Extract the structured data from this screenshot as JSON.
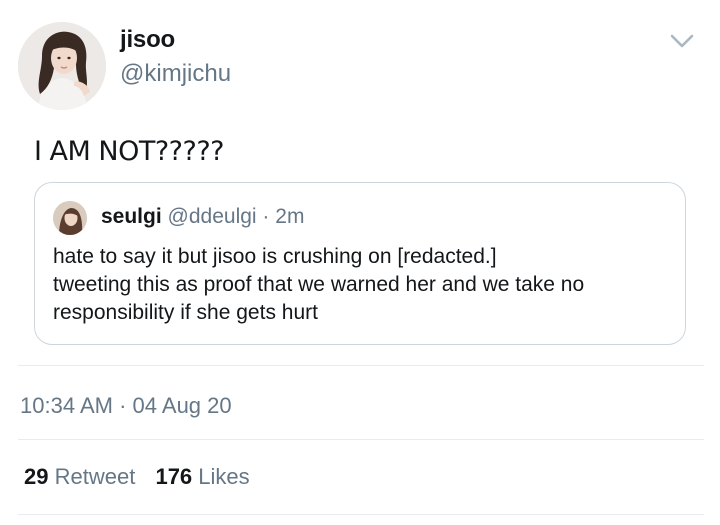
{
  "tweet": {
    "author": {
      "name": "jisoo",
      "handle": "@kimjichu"
    },
    "text": "I AM NOT?????",
    "menu_icon": "chevron-down-icon"
  },
  "quote": {
    "author": {
      "name": "seulgi",
      "handle": "@ddeulgi"
    },
    "separator": "·",
    "time": "2m",
    "lines": [
      "hate to  say it but jisoo is crushing on [redacted.]",
      "tweeting this as proof that we warned her and we take no",
      "responsibility if she gets hurt"
    ]
  },
  "meta": {
    "time": "10:34 AM",
    "separator": "·",
    "date": "04 Aug 20"
  },
  "stats": {
    "retweets": {
      "count": "29",
      "label": "Retweet"
    },
    "likes": {
      "count": "176",
      "label": "Likes"
    }
  },
  "colors": {
    "text": "#14171a",
    "secondary": "#657786",
    "border": "#ccd6dd",
    "divider": "#e6ecf0",
    "chevron": "#aab8c2"
  }
}
